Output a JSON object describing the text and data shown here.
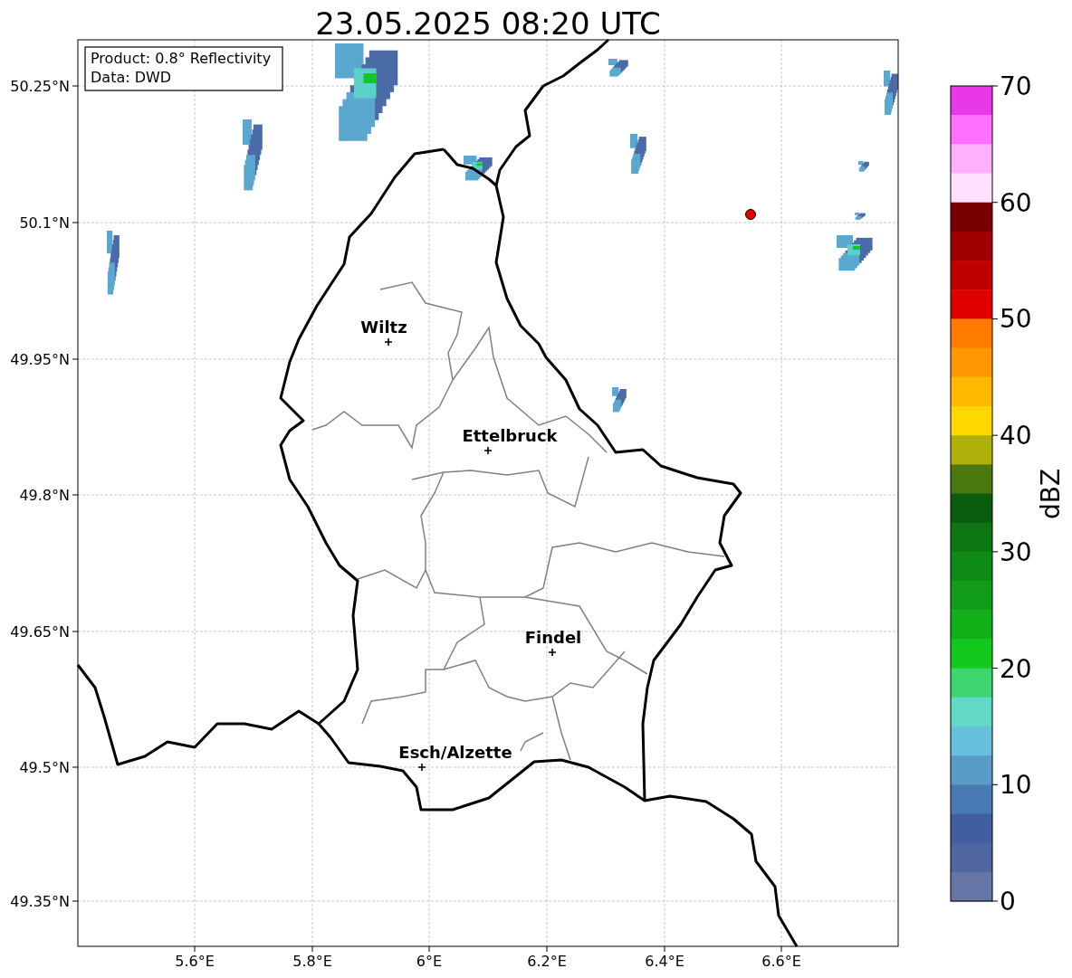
{
  "title": "23.05.2025 08:20 UTC",
  "info_box": [
    "Product: 0.8° Reflectivity",
    "Data: DWD"
  ],
  "lat_ticks": [
    "50.25°N",
    "50.1°N",
    "49.95°N",
    "49.8°N",
    "49.65°N",
    "49.5°N",
    "49.35°N"
  ],
  "lon_ticks": [
    "5.6°E",
    "5.8°E",
    "6°E",
    "6.2°E",
    "6.4°E",
    "6.6°E"
  ],
  "cities": [
    "Wiltz",
    "Ettelbruck",
    "Findel",
    "Esch/Alzette"
  ],
  "colorbar": {
    "label": "dBZ",
    "ticks": [
      "70",
      "60",
      "50",
      "40",
      "30",
      "20",
      "10",
      "0"
    ],
    "steps": [
      {
        "color": "#e838e8"
      },
      {
        "color": "#ff70ff"
      },
      {
        "color": "#ffb0ff"
      },
      {
        "color": "#ffe0ff"
      },
      {
        "color": "#780000"
      },
      {
        "color": "#a00000"
      },
      {
        "color": "#c00000"
      },
      {
        "color": "#e00000"
      },
      {
        "color": "#ff7c00"
      },
      {
        "color": "#ff9800"
      },
      {
        "color": "#ffb800"
      },
      {
        "color": "#ffd800"
      },
      {
        "color": "#b0b00a"
      },
      {
        "color": "#4a780e"
      },
      {
        "color": "#0a5c0e"
      },
      {
        "color": "#0c7612"
      },
      {
        "color": "#0e8a16"
      },
      {
        "color": "#109c18"
      },
      {
        "color": "#10b018"
      },
      {
        "color": "#12c81c"
      },
      {
        "color": "#3ed46e"
      },
      {
        "color": "#62d8c6"
      },
      {
        "color": "#66c0de"
      },
      {
        "color": "#5a9cc8"
      },
      {
        "color": "#4a7ab3"
      },
      {
        "color": "#425ea0"
      },
      {
        "color": "#5066a0"
      },
      {
        "color": "#6475a6"
      }
    ]
  }
}
